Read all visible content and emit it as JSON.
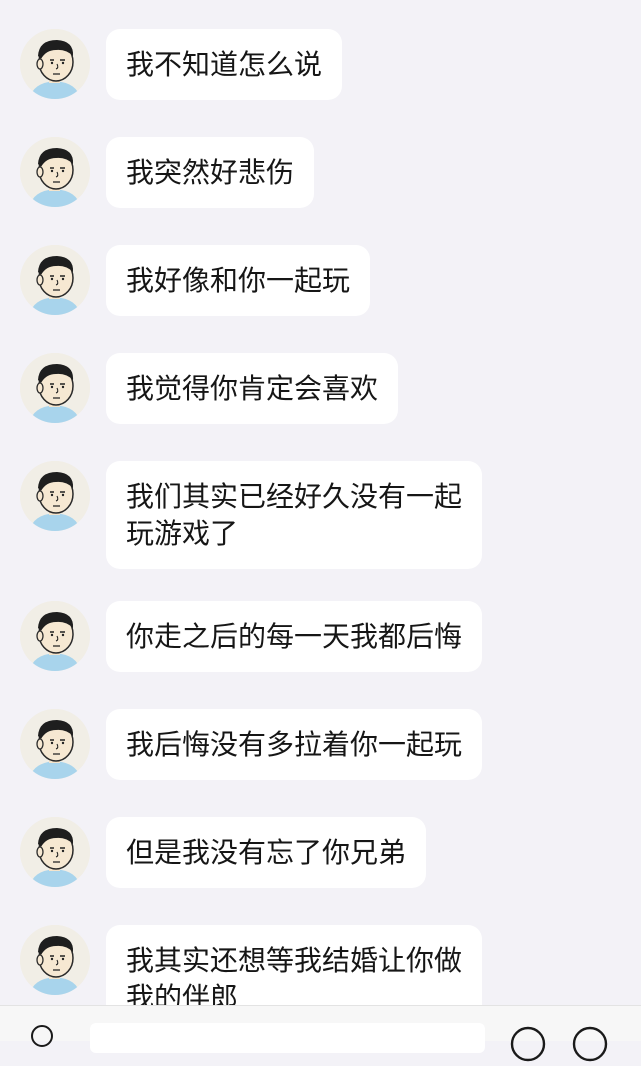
{
  "messages": [
    {
      "text": "我不知道怎么说"
    },
    {
      "text": "我突然好悲伤"
    },
    {
      "text": "我好像和你一起玩"
    },
    {
      "text": "我觉得你肯定会喜欢"
    },
    {
      "text": "我们其实已经好久没有一起\n玩游戏了"
    },
    {
      "text": "你走之后的每一天我都后悔"
    },
    {
      "text": "我后悔没有多拉着你一起玩"
    },
    {
      "text": "但是我没有忘了你兄弟"
    },
    {
      "text": "我其实还想等我结婚让你做\n我的伴郎"
    }
  ],
  "input_bar": {
    "value": ""
  },
  "icons": {
    "avatar": "cartoon-boy-avatar",
    "voice": "voice-icon",
    "emoji": "emoji-icon",
    "plus": "plus-icon"
  }
}
